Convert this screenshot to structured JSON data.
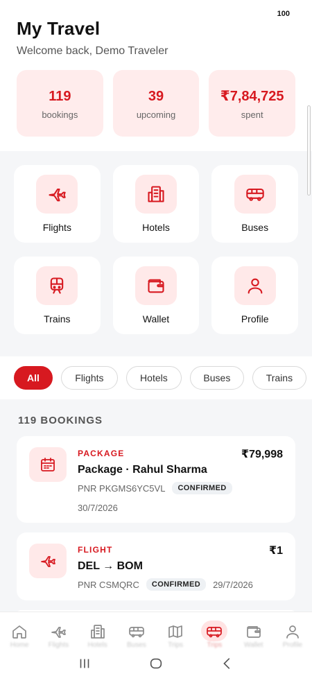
{
  "status": {
    "number": "100"
  },
  "header": {
    "title": "My Travel",
    "subtitle": "Welcome back, Demo Traveler"
  },
  "stats": [
    {
      "value": "119",
      "label": "bookings"
    },
    {
      "value": "39",
      "label": "upcoming"
    },
    {
      "value": "₹7,84,725",
      "label": "spent"
    }
  ],
  "services": [
    {
      "label": "Flights",
      "icon": "plane-icon"
    },
    {
      "label": "Hotels",
      "icon": "building-icon"
    },
    {
      "label": "Buses",
      "icon": "bus-icon"
    },
    {
      "label": "Trains",
      "icon": "train-icon"
    },
    {
      "label": "Wallet",
      "icon": "wallet-icon"
    },
    {
      "label": "Profile",
      "icon": "user-icon"
    }
  ],
  "filters": {
    "selected": "All",
    "items": [
      "All",
      "Flights",
      "Hotels",
      "Buses",
      "Trains"
    ]
  },
  "bookings_section": {
    "heading": "119 BOOKINGS"
  },
  "bookings": [
    {
      "type": "PACKAGE",
      "name": "Package · Rahul Sharma",
      "pnr": "PNR PKGMS6YC5VL",
      "status": "CONFIRMED",
      "date": "30/7/2026",
      "price": "₹79,998",
      "icon": "calendar-icon"
    },
    {
      "type": "FLIGHT",
      "name": "DEL → BOM",
      "pnr": "PNR CSMQRC",
      "status": "CONFIRMED",
      "date": "29/7/2026",
      "price": "₹1",
      "icon": "plane-icon"
    }
  ],
  "bottom_nav": {
    "active": "Trips",
    "items": [
      {
        "label": "Home",
        "icon": "home-icon"
      },
      {
        "label": "Flights",
        "icon": "plane-icon"
      },
      {
        "label": "Hotels",
        "icon": "building-icon"
      },
      {
        "label": "Buses",
        "icon": "bus-icon"
      },
      {
        "label": "Trips",
        "icon": "map-icon"
      },
      {
        "label": "Trips",
        "icon": "bus-icon"
      },
      {
        "label": "Wallet",
        "icon": "wallet-icon"
      },
      {
        "label": "Profile",
        "icon": "user-icon"
      }
    ]
  },
  "colors": {
    "accent": "#d71920",
    "accent_soft": "#ffe9e9",
    "background": "#f5f6f8"
  }
}
